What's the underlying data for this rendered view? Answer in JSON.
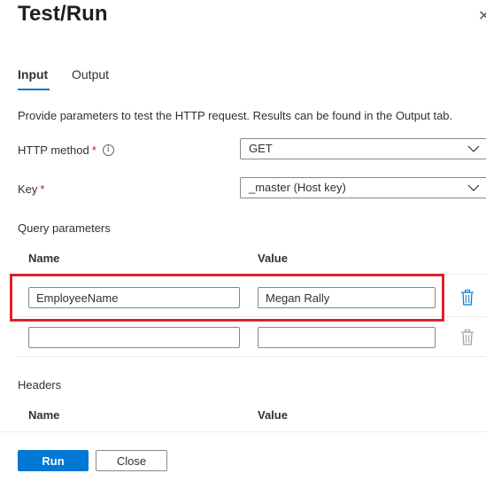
{
  "panel": {
    "title": "Test/Run",
    "close_icon": "close-icon"
  },
  "tabs": [
    {
      "label": "Input",
      "active": true
    },
    {
      "label": "Output",
      "active": false
    }
  ],
  "description": "Provide parameters to test the HTTP request. Results can be found in the Output tab.",
  "http_method": {
    "label": "HTTP method",
    "required_mark": "*",
    "info_icon": "info-icon",
    "value": "GET"
  },
  "key": {
    "label": "Key",
    "required_mark": "*",
    "value": "_master (Host key)"
  },
  "query_parameters": {
    "label": "Query parameters",
    "columns": {
      "name": "Name",
      "value": "Value"
    },
    "rows": [
      {
        "name": "EmployeeName",
        "value": "Megan Rally",
        "delete_icon": "trash-icon",
        "highlighted": true
      },
      {
        "name": "",
        "value": "",
        "delete_icon": "trash-icon",
        "highlighted": false
      }
    ]
  },
  "headers": {
    "label": "Headers",
    "columns": {
      "name": "Name",
      "value": "Value"
    }
  },
  "footer": {
    "run_label": "Run",
    "close_label": "Close"
  },
  "colors": {
    "accent": "#0078d4",
    "highlight": "#d9232e",
    "required": "#a4262c"
  }
}
